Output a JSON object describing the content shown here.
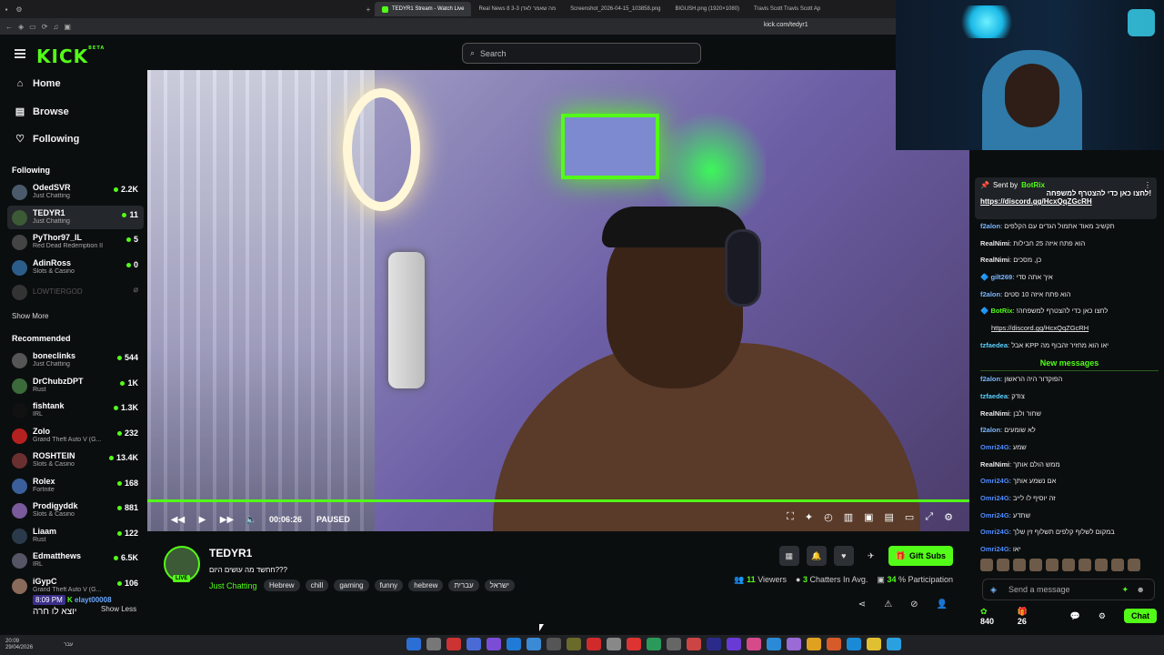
{
  "browser": {
    "tabs": [
      {
        "label": "TEDYR1 Stream - Watch Live",
        "active": true
      },
      {
        "label": "Real News 8 3-3 מה שאמר לאדן"
      },
      {
        "label": "Screenshot_2026-04-15_103858.png"
      },
      {
        "label": "BIGUSH.png (1920×1080)"
      },
      {
        "label": "Travis Scott Travis Scott Ap"
      }
    ],
    "url": "kick.com/tedyr1"
  },
  "sidebar": {
    "logo": "KICK",
    "logo_badge": "BETA",
    "nav": [
      {
        "label": "Home",
        "icon": "home-icon"
      },
      {
        "label": "Browse",
        "icon": "browse-icon"
      },
      {
        "label": "Following",
        "icon": "heart-icon"
      }
    ],
    "following_title": "Following",
    "following": [
      {
        "name": "OdedSVR",
        "category": "Just Chatting",
        "viewers": "2.2K"
      },
      {
        "name": "TEDYR1",
        "category": "Just Chatting",
        "viewers": "11",
        "active": true
      },
      {
        "name": "PyThor97_IL",
        "category": "Red Dead Redemption II",
        "viewers": "5"
      },
      {
        "name": "AdinRoss",
        "category": "Slots & Casino",
        "viewers": "0"
      },
      {
        "name": "LOWTIERGOD",
        "category": "",
        "viewers": "",
        "offline": true
      }
    ],
    "show_more": "Show More",
    "recommended_title": "Recommended",
    "recommended": [
      {
        "name": "boneclinks",
        "category": "Just Chatting",
        "viewers": "544"
      },
      {
        "name": "DrChubzDPT",
        "category": "Rust",
        "viewers": "1K"
      },
      {
        "name": "fishtank",
        "category": "IRL",
        "viewers": "1.3K"
      },
      {
        "name": "Zolo",
        "category": "Grand Theft Auto V (G...",
        "viewers": "232"
      },
      {
        "name": "ROSHTEIN",
        "category": "Slots & Casino",
        "viewers": "13.4K"
      },
      {
        "name": "Rolex",
        "category": "Fortnite",
        "viewers": "168"
      },
      {
        "name": "Prodigyddk",
        "category": "Slots & Casino",
        "viewers": "881"
      },
      {
        "name": "Liaam",
        "category": "Rust",
        "viewers": "122"
      },
      {
        "name": "Edmatthews",
        "category": "IRL",
        "viewers": "6.5K"
      },
      {
        "name": "iGypC",
        "category": "Grand Theft Auto V (G...",
        "viewers": "106"
      }
    ],
    "show_less": "Show Less"
  },
  "search": {
    "placeholder": "Search"
  },
  "player": {
    "time": "00:06:26",
    "status": "PAUSED",
    "progress": 1.0
  },
  "stream": {
    "name": "TEDYR1",
    "live_badge": "LIVE",
    "title": "חחשד מה עושים היום???",
    "category": "Just Chatting",
    "tags": [
      "Hebrew",
      "chill",
      "gaming",
      "funny",
      "hebrew",
      "עברית",
      "ישראל"
    ],
    "gift_label": "Gift Subs",
    "viewers": "11",
    "viewers_label": "Viewers",
    "chatters": "3",
    "chatters_label": "Chatters In Avg.",
    "participation": "34",
    "participation_label": "% Participation"
  },
  "chat": {
    "pinned": {
      "sent_by": "Sent by",
      "bot": "BotRix",
      "text": "!לחצו כאן כדי להצטרף למשפחה",
      "link": "https://discord.gg/HcxQqZGcRH"
    },
    "messages": [
      {
        "user": "f2alon",
        "text": "תקשיב מאוד אתמול הגדים עם הקלפים",
        "color": "#7ab7ff"
      },
      {
        "user": "RealNimi",
        "text": "הוא פתח איזה 25 חבילות",
        "color": "#ffffff"
      },
      {
        "user": "RealNimi",
        "text": "כן, מסכים",
        "color": "#ffffff"
      },
      {
        "user": "gilt269",
        "text": "איך אתה סדי",
        "color": "#7ab7ff"
      },
      {
        "user": "f2alon",
        "text": "הוא פתח איזה 10 סטים",
        "color": "#7ab7ff"
      },
      {
        "user": "BotRix",
        "text": "!לחצו כאן כדי להצטרף למשפחה",
        "color": "#53fc18"
      },
      {
        "user": "",
        "text": "https://discord.gg/HcxQqZGcRH",
        "color": "#7ab7ff"
      },
      {
        "user": "tzfaedea",
        "text": "אבל KPP יאו הוא מחזיר זהבוף מה",
        "color": "#5ad0ff"
      }
    ],
    "new_messages_label": "New messages",
    "messages2": [
      {
        "user": "f2alon",
        "text": "הפוקדור היה הראשון",
        "color": "#7ab7ff"
      },
      {
        "user": "tzfaedea",
        "text": "צודק",
        "color": "#5ad0ff"
      },
      {
        "user": "RealNimi",
        "text": "שחור ולבן",
        "color": "#ffffff"
      },
      {
        "user": "f2alon",
        "text": "לא שומעים",
        "color": "#7ab7ff"
      },
      {
        "user": "Omri24G",
        "text": "שמע",
        "color": "#4f8bff"
      },
      {
        "user": "RealNimi",
        "text": "ממש הולם אותך",
        "color": "#ffffff"
      },
      {
        "user": "Omri24G",
        "text": "אם נשמע אותך",
        "color": "#4f8bff"
      },
      {
        "user": "Omri24G",
        "text": "זה יוסיף לו לייב",
        "color": "#4f8bff"
      },
      {
        "user": "Omri24G",
        "text": "שתדע",
        "color": "#4f8bff"
      },
      {
        "user": "Omri24G",
        "text": "במקום לשלוף קלפים תשלוף זין שלך",
        "color": "#4f8bff"
      },
      {
        "user": "Omri24G",
        "text": "יאו",
        "color": "#4f8bff"
      }
    ],
    "send_placeholder": "Send a message",
    "points": "840",
    "gifts": "26",
    "chat_button": "Chat"
  },
  "overlay": {
    "time_badge": "8:09 PM",
    "sender": "elayt00008",
    "text": "יוצא לו חרה"
  },
  "taskbar": {
    "time": "20:09",
    "date": "29/04/2026",
    "lang": "עבר"
  },
  "colors": {
    "accent": "#53fc18",
    "background": "#0b0e0f"
  }
}
